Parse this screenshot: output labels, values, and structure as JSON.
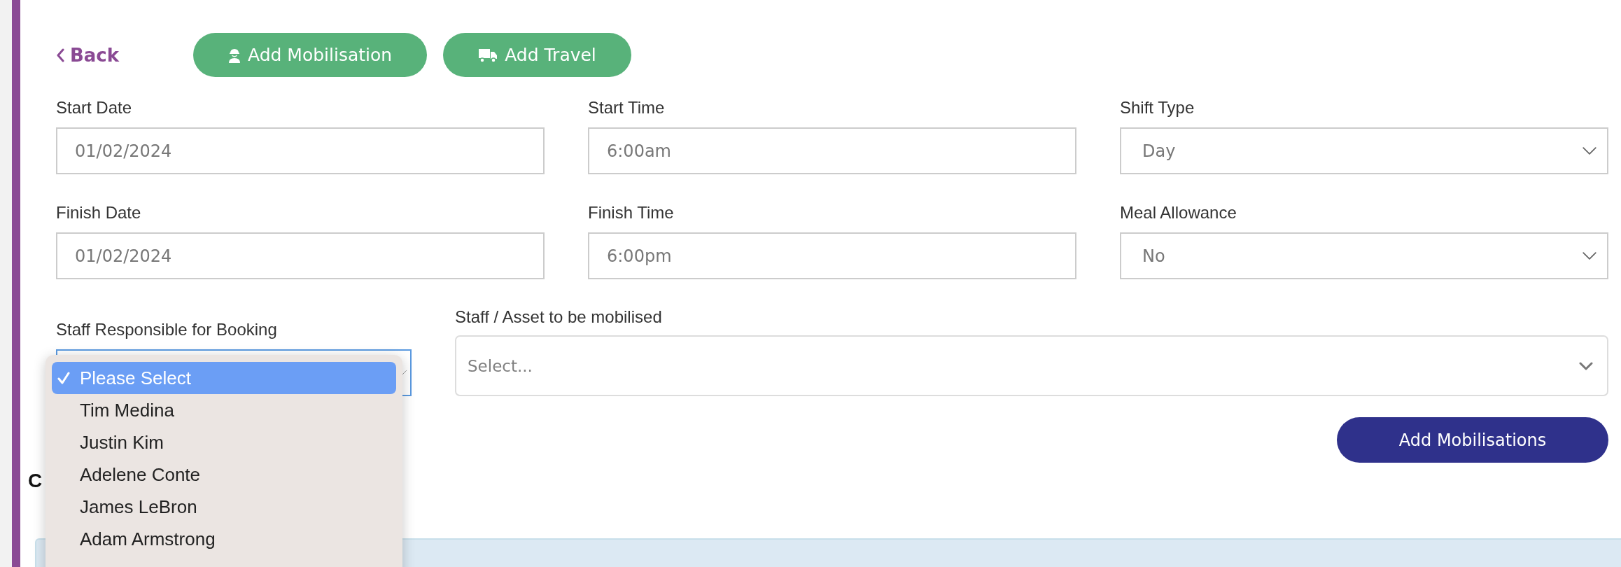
{
  "back_link": {
    "label": "Back"
  },
  "actions": [
    {
      "label": "Add Mobilisation",
      "kind": "worker"
    },
    {
      "label": "Add Travel",
      "kind": "truck"
    }
  ],
  "fields": [
    {
      "label": "Start Date",
      "value": "01/02/2024",
      "kind": "input"
    },
    {
      "label": "Start Time",
      "value": "6:00am",
      "kind": "input"
    },
    {
      "label": "Shift Type",
      "value": "Day",
      "kind": "select"
    },
    {
      "label": "Finish Date",
      "value": "01/02/2024",
      "kind": "input"
    },
    {
      "label": "Finish Time",
      "value": "6:00pm",
      "kind": "input"
    },
    {
      "label": "Meal Allowance",
      "value": "No",
      "kind": "select"
    }
  ],
  "staff_responsible": {
    "label": "Staff Responsible for Booking",
    "expanded": true,
    "options": [
      {
        "label": "Please Select",
        "selected": true
      },
      {
        "label": "Tim Medina",
        "selected": false
      },
      {
        "label": "Justin Kim",
        "selected": false
      },
      {
        "label": "Adelene Conte",
        "selected": false
      },
      {
        "label": "James LeBron",
        "selected": false
      },
      {
        "label": "Adam Armstrong",
        "selected": false
      }
    ]
  },
  "staff_asset": {
    "label": "Staff / Asset to be mobilised",
    "placeholder": "Select..."
  },
  "submit_button": {
    "label": "Add Mobilisations"
  },
  "section": {
    "heading": "C"
  }
}
